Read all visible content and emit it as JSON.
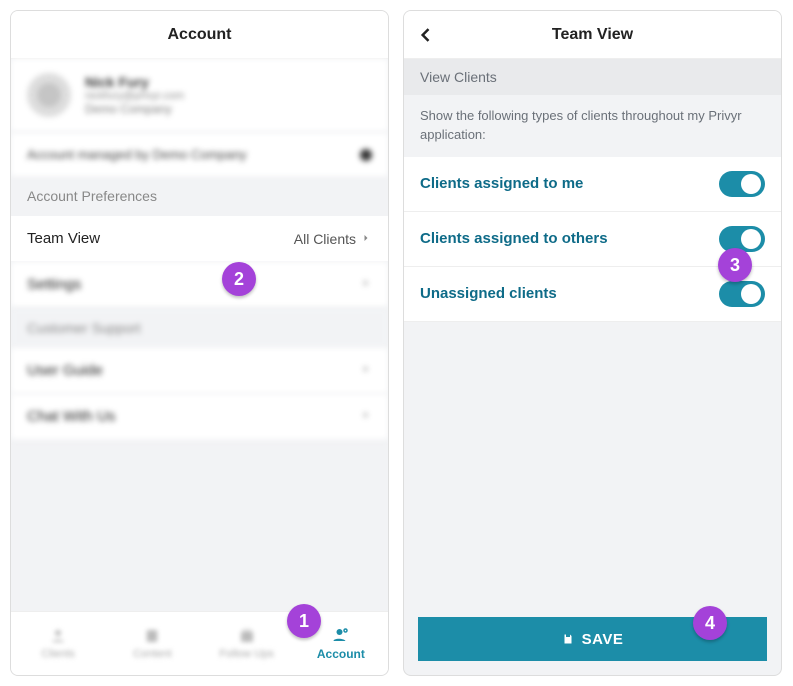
{
  "left": {
    "header": "Account",
    "profile": {
      "name": "Nick Fury",
      "email": "nickfury@privyr.com",
      "company": "Demo Company"
    },
    "managed": "Account managed by Demo Company",
    "preferencesHeader": "Account Preferences",
    "teamViewLabel": "Team View",
    "teamViewValue": "All Clients",
    "settingsLabel": "Settings",
    "supportHeader": "Customer Support",
    "userGuideLabel": "User Guide",
    "chatLabel": "Chat With Us",
    "tabs": {
      "t1": "Clients",
      "t2": "Content",
      "t3": "Follow Ups",
      "t4": "Account"
    }
  },
  "right": {
    "header": "Team View",
    "section": "View Clients",
    "desc": "Show the following types of clients throughout my Privyr application:",
    "opt1": "Clients assigned to me",
    "opt2": "Clients assigned to others",
    "opt3": "Unassigned clients",
    "save": "SAVE"
  },
  "steps": {
    "s1": "1",
    "s2": "2",
    "s3": "3",
    "s4": "4"
  }
}
